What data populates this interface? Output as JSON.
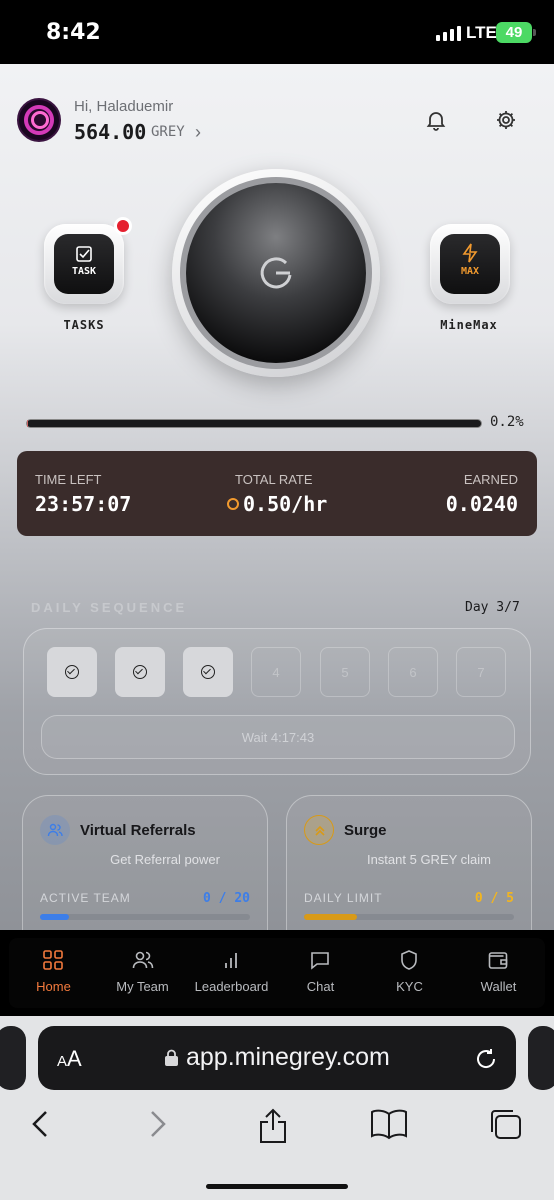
{
  "status_bar": {
    "time": "8:42",
    "network": "LTE",
    "battery": "49"
  },
  "header": {
    "greeting": "Hi, Haladuemir",
    "balance": "564.00",
    "unit": "GREY",
    "chevron": "›",
    "icons": [
      "bell-icon",
      "gear-icon"
    ]
  },
  "actions": {
    "tasks": {
      "badge_text": "TASK",
      "label": "TASKS",
      "has_notification": true
    },
    "mine_max": {
      "badge_text": "MAX",
      "label": "MineMax"
    }
  },
  "progress": {
    "percent_label": "0.2%",
    "fraction": 0.002
  },
  "stats": {
    "time_left_label": "TIME LEFT",
    "time_left": "23:57:07",
    "rate_label": "TOTAL RATE",
    "rate": "0.50/hr",
    "earned_label": "EARNED",
    "earned": "0.0240"
  },
  "daily": {
    "title": "DAILY SEQUENCE",
    "day_label": "Day 3/7",
    "days": [
      {
        "label": "",
        "done": true
      },
      {
        "label": "",
        "done": true
      },
      {
        "label": "",
        "done": true
      },
      {
        "label": "4",
        "done": false
      },
      {
        "label": "5",
        "done": false
      },
      {
        "label": "6",
        "done": false
      },
      {
        "label": "7",
        "done": false
      }
    ],
    "wait_label": "Wait 4:17:43"
  },
  "cards": {
    "referrals": {
      "title": "Virtual Referrals",
      "subtitle": "Get Referral power",
      "metric_label": "ACTIVE TEAM",
      "metric_value": "0 / 20",
      "fill_fraction": 0.14,
      "color": "#3d7ee8"
    },
    "surge": {
      "title": "Surge",
      "subtitle": "Instant 5 GREY claim",
      "metric_label": "DAILY LIMIT",
      "metric_value": "0 / 5",
      "fill_fraction": 0.25,
      "color": "#f2b51f"
    }
  },
  "nav": {
    "items": [
      {
        "label": "Home",
        "active": true
      },
      {
        "label": "My Team",
        "active": false
      },
      {
        "label": "Leaderboard",
        "active": false
      },
      {
        "label": "Chat",
        "active": false
      },
      {
        "label": "KYC",
        "active": false
      },
      {
        "label": "Wallet",
        "active": false
      }
    ]
  },
  "browser": {
    "text_size": "AA",
    "url": "app.minegrey.com"
  },
  "colors": {
    "accent": "#f37a3d",
    "stats_bg": "#3a2c2b",
    "active_blue": "#3d7ee8",
    "active_gold": "#f2b51f"
  }
}
